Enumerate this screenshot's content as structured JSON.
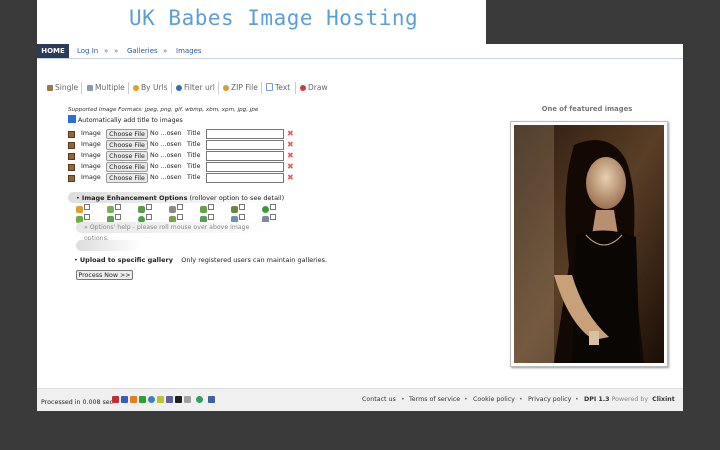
{
  "banner": {
    "title": "UK Babes Image Hosting"
  },
  "nav": {
    "home": "HOME",
    "login": "Log In",
    "sep1": "»",
    "sep2": "»",
    "galleries": "Galleries",
    "sep3": "»",
    "images": "Images"
  },
  "tabs": [
    {
      "label": "Single",
      "icon": "single-image-icon",
      "color": "#9a7a4a"
    },
    {
      "label": "Multiple",
      "icon": "multiple-images-icon",
      "color": "#8a9ab0"
    },
    {
      "label": "By Urls",
      "icon": "url-icon",
      "color": "#e0a020"
    },
    {
      "label": "Filter url",
      "icon": "filter-icon",
      "color": "#3a6ab0"
    },
    {
      "label": "ZIP File",
      "icon": "zip-icon",
      "color": "#d0a030"
    },
    {
      "label": "Text",
      "icon": "text-icon",
      "color": "#7a9ad0"
    },
    {
      "label": "Draw",
      "icon": "draw-icon",
      "color": "#c04040"
    }
  ],
  "upload": {
    "formats": "Supported Image Formats: jpeg, png, gif, wbmp, xbm, xpm, jpg, jpe",
    "auto_title": "Automatically add title to images",
    "auto_title_checked": true,
    "rows": [
      {
        "label": "Image",
        "button": "Choose File",
        "status": "No ...osen",
        "title_label": "Title",
        "title_value": "",
        "remove": "✖"
      },
      {
        "label": "Image",
        "button": "Choose File",
        "status": "No ...osen",
        "title_label": "Title",
        "title_value": "",
        "remove": "✖"
      },
      {
        "label": "Image",
        "button": "Choose File",
        "status": "No ...osen",
        "title_label": "Title",
        "title_value": "",
        "remove": "✖"
      },
      {
        "label": "Image",
        "button": "Choose File",
        "status": "No ...osen",
        "title_label": "Title",
        "title_value": "",
        "remove": "✖"
      },
      {
        "label": "Image",
        "button": "Choose File",
        "status": "No ...osen",
        "title_label": "Title",
        "title_value": "",
        "remove": "✖"
      }
    ]
  },
  "enhancement": {
    "title": "Image Enhancement Options",
    "subtitle": "(rollover option to see detail)",
    "options_row1": [
      "#e0a030",
      "#7ab05a",
      "#5a9a4a",
      "#8a8a8a",
      "#6aa04a",
      "#6a8a3a",
      "#3a9a3a"
    ],
    "options_row2": [
      "#6ab040",
      "#5aa050",
      "#4aa040",
      "#7aa04a",
      "#5a9a5a",
      "#7090b0",
      "#7a8aa0"
    ],
    "help": "» Options' help - please roll mouse over above image options."
  },
  "gallery": {
    "label": "Upload to specific gallery",
    "note": "Only registered users can maintain galleries."
  },
  "process_button": "Process Now >>",
  "featured": {
    "title": "One of featured images"
  },
  "footer": {
    "processed": "Processed in 0.008 sec",
    "badge_colors": [
      "#c03030",
      "#3060c0",
      "#e08020",
      "#30a030",
      "#4080c0",
      "#c0c030",
      "#6060a0",
      "#202020",
      "#a0a0a0",
      "#30a060",
      "#4060a0"
    ],
    "links": [
      "Contact us",
      "Terms of service",
      "Cookie policy",
      "Privacy policy"
    ],
    "dpi": "DPI 1.3",
    "powered": "Powered by",
    "brand": "Clixint"
  }
}
